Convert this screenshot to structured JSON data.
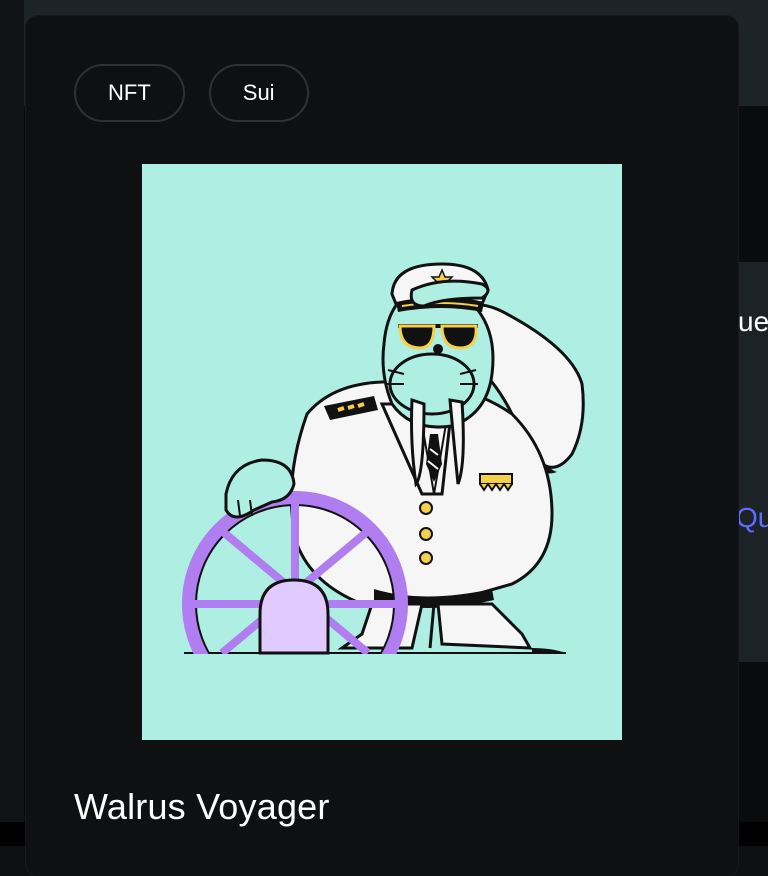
{
  "background": {
    "right_text_top": "ue",
    "right_link_text": "Qu"
  },
  "modal": {
    "tags": [
      "NFT",
      "Sui"
    ],
    "title": "Walrus Voyager",
    "art_background": "#aeeee3"
  },
  "colors": {
    "modal_bg": "#0f1012",
    "tag_border": "#2e3236",
    "wheel_purple": "#b07ef0",
    "wheel_hub": "#e1caff",
    "walrus_teal": "#aeeee3",
    "uniform_white": "#f6f6f6",
    "gold": "#f7d04a",
    "link_blue": "#5b6cff"
  }
}
